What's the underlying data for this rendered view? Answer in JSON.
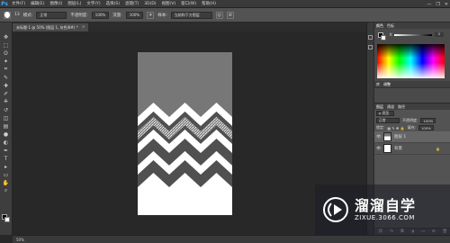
{
  "app": {
    "logo": "Ps"
  },
  "menu": [
    "文件(F)",
    "编辑(E)",
    "图像(I)",
    "图层(L)",
    "文字(Y)",
    "选择(S)",
    "滤镜(T)",
    "3D(D)",
    "视图(V)",
    "窗口(W)",
    "帮助(H)"
  ],
  "window_controls": {
    "minimize": "—",
    "restore": "❐",
    "close": "✕"
  },
  "options": {
    "brush_size": "13",
    "mode_label": "模式:",
    "mode_value": "正常",
    "opacity_label": "不透明度:",
    "opacity_value": "100%",
    "flow_label": "流量:",
    "flow_value": "100%",
    "sample_label": "样本:",
    "sample_value": "当前和下方图层"
  },
  "document_tab": {
    "label": "未标题-1 @ 50% (图层 1, 灰色/8#) *",
    "close": "×"
  },
  "tools": [
    "move-tool-icon",
    "marquee-tool-icon",
    "lasso-tool-icon",
    "magic-wand-icon",
    "crop-tool-icon",
    "eyedropper-icon",
    "healing-brush-icon",
    "brush-tool-icon",
    "clone-stamp-icon",
    "history-brush-icon",
    "eraser-icon",
    "gradient-icon",
    "blur-tool-icon",
    "dodge-tool-icon",
    "pen-tool-icon",
    "type-tool-icon",
    "path-select-icon",
    "shape-tool-icon",
    "hand-tool-icon",
    "zoom-tool-icon"
  ],
  "tool_glyphs": [
    "✥",
    "⬚",
    "ʘ",
    "✦",
    "⌗",
    "✎",
    "✚",
    "✐",
    "⎈",
    "↺",
    "◫",
    "▤",
    "●",
    "◐",
    "✒",
    "T",
    "▸",
    "▭",
    "✋",
    "⌕"
  ],
  "status": {
    "zoom": "50%"
  },
  "color_panel": {
    "tabs": [
      "颜色",
      "色板"
    ],
    "channel_label": "K",
    "channel_value": "0"
  },
  "adjustments": {
    "tabs": [
      "库",
      "调整"
    ]
  },
  "layers_panel": {
    "tabs": [
      "图层",
      "通道",
      "路径"
    ],
    "filter_value": "ρ 类型",
    "blend_mode": "正常",
    "opacity_label": "不透明度:",
    "opacity_value": "100%",
    "lock_label": "锁定:",
    "fill_label": "填充:",
    "fill_value": "100%",
    "layers": [
      {
        "name": "图层 1",
        "selected": true
      },
      {
        "name": "背景",
        "selected": false,
        "locked": true
      }
    ],
    "footer_icons": [
      "link-icon",
      "fx-icon",
      "mask-icon",
      "adjustment-icon",
      "group-icon",
      "new-layer-icon",
      "trash-icon"
    ],
    "footer_glyphs": [
      "⛓",
      "fx",
      "◘",
      "◑",
      "▭",
      "⊞",
      "🗑"
    ]
  },
  "watermark": {
    "title": "溜溜自学",
    "url": "ZIXUE.3066.COM"
  },
  "colors": {
    "canvas_gray": "#777777",
    "chevron_dark": "#505050",
    "glitter": "#b0b0b0",
    "white": "#ffffff"
  }
}
